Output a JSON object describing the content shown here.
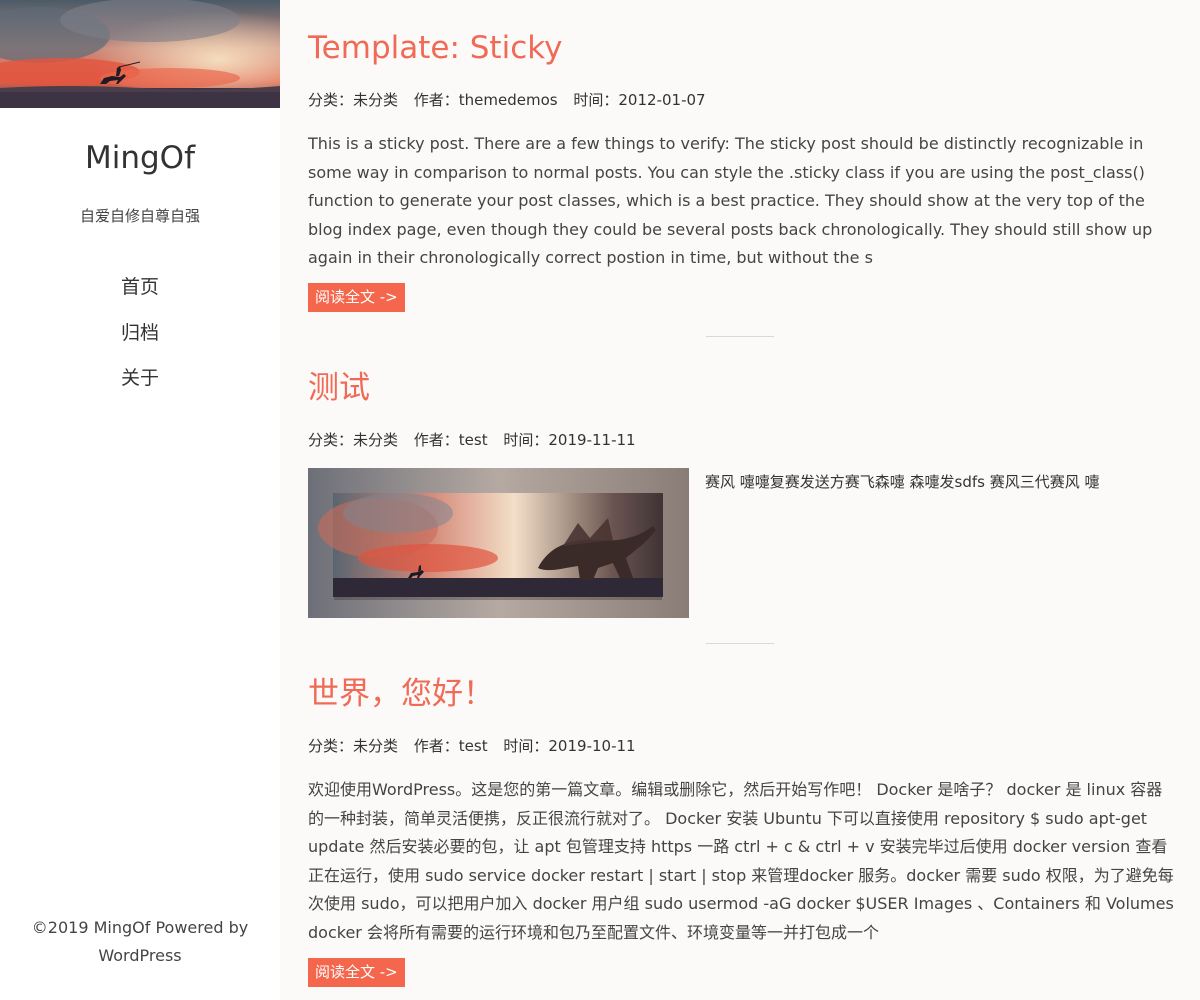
{
  "sidebar": {
    "site_title": "MingOf",
    "tagline": "自爱自修自尊自强",
    "nav": [
      {
        "label": "首页"
      },
      {
        "label": "归档"
      },
      {
        "label": "关于"
      }
    ],
    "footer": "©2019 MingOf Powered by WordPress"
  },
  "posts": [
    {
      "title": "Template: Sticky",
      "category": "分类：未分类",
      "author": "作者：themedemos",
      "date": "时间：2012-01-07",
      "excerpt": "This is a sticky post. There are a few things to verify: The sticky post should be distinctly recognizable in some way in comparison to normal posts. You can style the .sticky class if you are using the post_class() function to generate your post classes, which is a best practice. They should show at the very top of the blog index page, even though they could be several posts back chronologically. They should still show up again in their chronologically correct postion in time, but without the s",
      "read_more": "阅读全文 ->"
    },
    {
      "title": "测试",
      "category": "分类：未分类",
      "author": "作者：test",
      "date": "时间：2019-11-11",
      "excerpt": "赛风 嚏嚏复赛发送方赛飞森嚏 森嚏发sdfs 赛风三代赛风 嚏"
    },
    {
      "title": "世界，您好！",
      "category": "分类：未分类",
      "author": "作者：test",
      "date": "时间：2019-10-11",
      "excerpt": "欢迎使用WordPress。这是您的第一篇文章。编辑或删除它，然后开始写作吧！ Docker 是啥子？ docker 是 linux 容器的一种封装，简单灵活便携，反正很流行就对了。 Docker 安装 Ubuntu 下可以直接使用 repository $ sudo apt-get update 然后安装必要的包，让 apt 包管理支持 https 一路 ctrl + c & ctrl + v 安装完毕过后使用 docker version 查看正在运行，使用 sudo service docker restart | start | stop  来管理docker 服务。docker 需要 sudo 权限，为了避免每次使用 sudo，可以把用户加入 docker 用户组 sudo usermod -aG docker $USER Images 、Containers 和 Volumes docker 会将所有需要的运行环境和包乃至配置文件、环境变量等一并打包成一个",
      "read_more": "阅读全文 ->"
    }
  ],
  "colors": {
    "accent": "#f06a55",
    "button": "#f5674c",
    "background": "#fbfaf8"
  }
}
